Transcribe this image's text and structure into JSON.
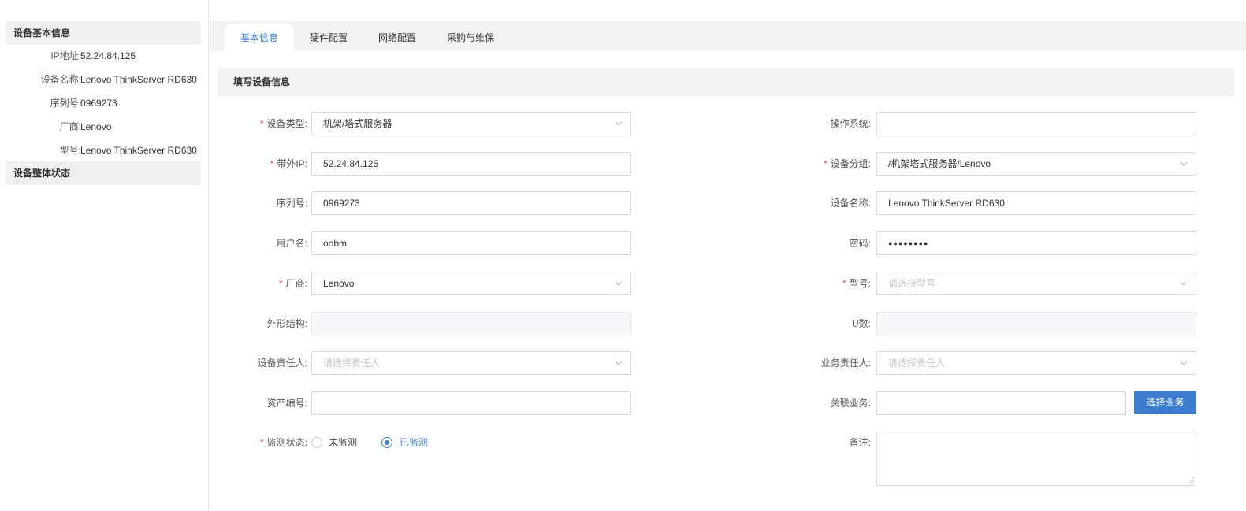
{
  "sidebar": {
    "basic_info_title": "设备基本信息",
    "rows": [
      {
        "label": "IP地址:",
        "value": "52.24.84.125"
      },
      {
        "label": "设备名称:",
        "value": "Lenovo ThinkServer RD630"
      },
      {
        "label": "序列号:",
        "value": "0969273"
      },
      {
        "label": "厂商:",
        "value": "Lenovo"
      },
      {
        "label": "型号:",
        "value": "Lenovo ThinkServer RD630"
      }
    ],
    "status_title": "设备整体状态"
  },
  "tabs": [
    {
      "label": "基本信息",
      "active": true
    },
    {
      "label": "硬件配置",
      "active": false
    },
    {
      "label": "网络配置",
      "active": false
    },
    {
      "label": "采购与维保",
      "active": false
    }
  ],
  "form": {
    "title": "填写设备信息",
    "device_type": {
      "label": "设备类型:",
      "value": "机架/塔式服务器"
    },
    "oob_ip": {
      "label": "带外IP:",
      "value": "52.24.84.125"
    },
    "serial": {
      "label": "序列号:",
      "value": "0969273"
    },
    "username": {
      "label": "用户名:",
      "value": "oobm"
    },
    "vendor": {
      "label": "厂商:",
      "value": "Lenovo"
    },
    "form_factor": {
      "label": "外形结构:",
      "value": ""
    },
    "owner": {
      "label": "设备责任人:",
      "placeholder": "请选择责任人"
    },
    "asset_no": {
      "label": "资产编号:",
      "value": ""
    },
    "monitor": {
      "label": "监测状态:",
      "options": [
        "未监测",
        "已监测"
      ],
      "selected": "已监测"
    },
    "os": {
      "label": "操作系统:",
      "value": ""
    },
    "group": {
      "label": "设备分组:",
      "value": "/机架塔式服务器/Lenovo"
    },
    "device_name": {
      "label": "设备名称:",
      "value": "Lenovo ThinkServer RD630"
    },
    "password": {
      "label": "密码:",
      "value": "●●●●●●●●"
    },
    "model": {
      "label": "型号:",
      "placeholder": "请选择型号"
    },
    "u_count": {
      "label": "U数:",
      "value": ""
    },
    "biz_owner": {
      "label": "业务责任人:",
      "placeholder": "请选择责任人"
    },
    "related_biz": {
      "label": "关联业务:",
      "value": "",
      "button": "选择业务"
    },
    "remark": {
      "label": "备注:",
      "value": ""
    }
  },
  "colors": {
    "accent": "#3d7dd0",
    "required": "#e94848"
  }
}
